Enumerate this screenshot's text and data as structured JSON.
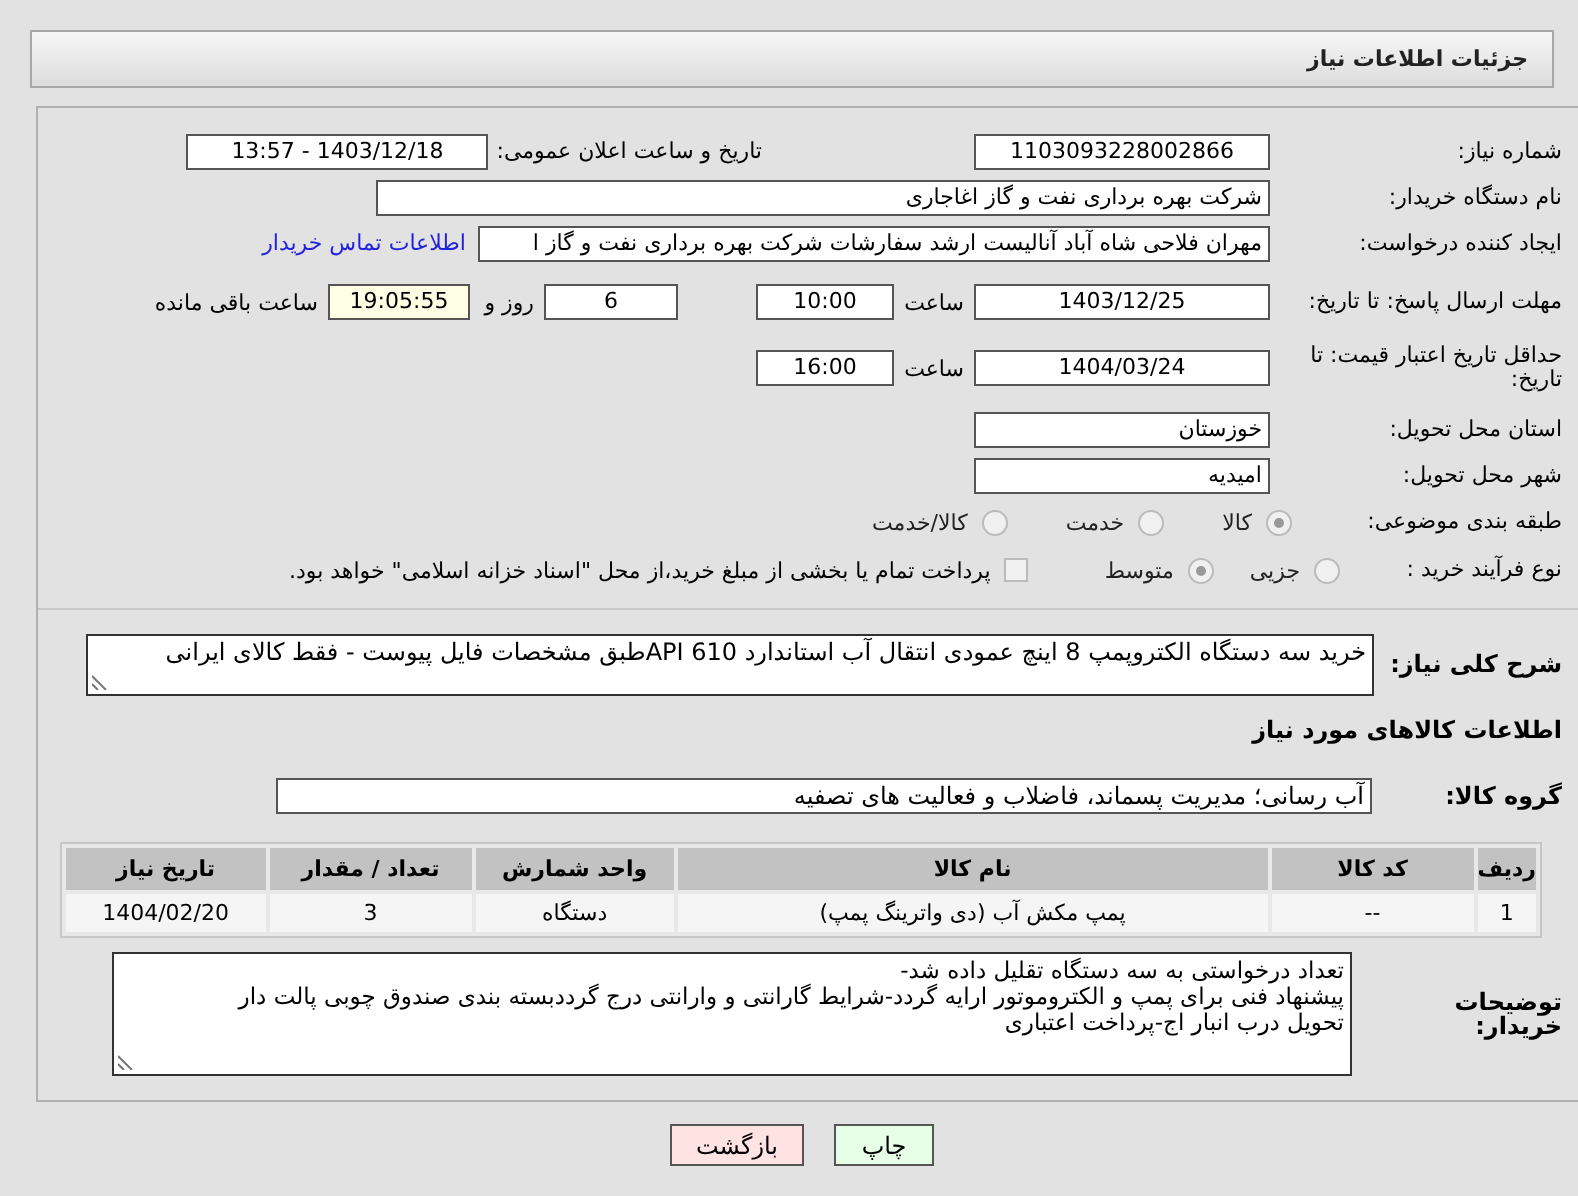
{
  "header": {
    "title": "جزئیات اطلاعات نیاز"
  },
  "need_number": {
    "label": "شماره نیاز:",
    "value": "1103093228002866"
  },
  "announce": {
    "label": "تاریخ و ساعت اعلان عمومی:",
    "value": "1403/12/18 - 13:57"
  },
  "buyer_org": {
    "label": "نام دستگاه خریدار:",
    "value": "شرکت بهره برداری نفت و گاز اغاجاری"
  },
  "requester": {
    "label": "ایجاد کننده درخواست:",
    "value": "مهران فلاحی شاه آباد آنالیست ارشد سفارشات شرکت بهره برداری نفت و گاز ا",
    "link": "اطلاعات تماس خریدار"
  },
  "reply_deadline": {
    "label": "مهلت ارسال پاسخ: تا تاریخ:",
    "date": "1403/12/25",
    "time_label": "ساعت",
    "time": "10:00",
    "days": "6",
    "days_label": "روز و",
    "remaining": "19:05:55",
    "remaining_label": "ساعت باقی مانده"
  },
  "price_validity": {
    "label": "حداقل تاریخ اعتبار قیمت: تا تاریخ:",
    "date": "1404/03/24",
    "time_label": "ساعت",
    "time": "16:00"
  },
  "province": {
    "label": "استان محل تحویل:",
    "value": "خوزستان"
  },
  "city": {
    "label": "شهر محل تحویل:",
    "value": "امیدیه"
  },
  "category": {
    "label": "طبقه بندی موضوعی:",
    "options": [
      {
        "label": "کالا",
        "selected": true
      },
      {
        "label": "خدمت",
        "selected": false
      },
      {
        "label": "کالا/خدمت",
        "selected": false
      }
    ]
  },
  "purchase_process": {
    "label": "نوع فرآیند خرید :",
    "options": [
      {
        "label": "جزیی",
        "selected": false
      },
      {
        "label": "متوسط",
        "selected": true
      }
    ],
    "payment_note": {
      "checked": false,
      "text": "پرداخت تمام یا بخشی از مبلغ خرید،از محل \"اسناد خزانه اسلامی\" خواهد بود."
    }
  },
  "description": {
    "label": "شرح کلی نیاز:",
    "value": "خرید سه دستگاه الکتروپمپ 8 اینچ عمودی انتقال آب  استاندارد API 610طبق مشخصات فایل پیوست - فقط کالای ایرانی"
  },
  "goods_section_title": "اطلاعات کالاهای مورد نیاز",
  "goods_group": {
    "label": "گروه کالا:",
    "value": "آب رسانی؛ مدیریت پسماند، فاضلاب و فعالیت های تصفیه"
  },
  "table": {
    "columns": [
      "ردیف",
      "کد کالا",
      "نام کالا",
      "واحد شمارش",
      "تعداد / مقدار",
      "تاریخ نیاز"
    ],
    "rows": [
      [
        "1",
        "--",
        "پمپ مکش آب (دی واترینگ پمپ)",
        "دستگاه",
        "3",
        "1404/02/20"
      ]
    ]
  },
  "buyer_notes": {
    "label": "توضیحات خریدار:",
    "value": "تعداد درخواستی به سه دستگاه تقلیل داده شد-\nپیشنهاد فنی برای پمپ و الکتروموتور ارایه گردد-شرایط گارانتی و وارانتی درج گرددبسته بندی صندوق چوبی پالت دار\nتحویل درب انبار اج-پرداخت اعتباری"
  },
  "buttons": [
    {
      "label": "چاپ",
      "kind": "print"
    },
    {
      "label": "بازگشت",
      "kind": "back"
    }
  ]
}
